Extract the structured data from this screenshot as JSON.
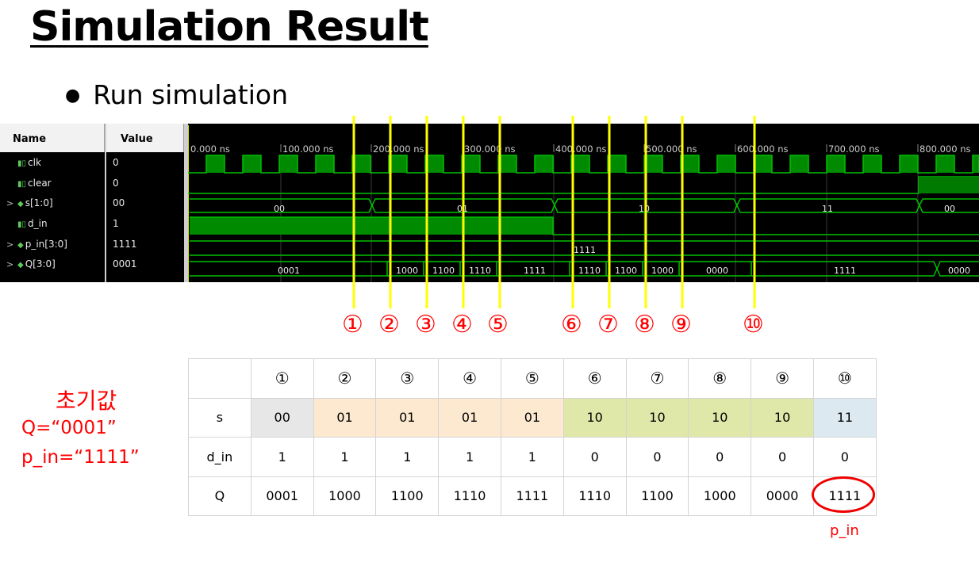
{
  "title": "Simulation Result",
  "bullet": "Run simulation",
  "waveform": {
    "headers": {
      "name": "Name",
      "value": "Value"
    },
    "signals": [
      {
        "name": "clk",
        "value": "0",
        "bus": false
      },
      {
        "name": "clear",
        "value": "0",
        "bus": false
      },
      {
        "name": "s[1:0]",
        "value": "00",
        "bus": true
      },
      {
        "name": "d_in",
        "value": "1",
        "bus": false
      },
      {
        "name": "p_in[3:0]",
        "value": "1111",
        "bus": true
      },
      {
        "name": "Q[3:0]",
        "value": "0001",
        "bus": true
      }
    ],
    "time_labels": [
      "0.000 ns",
      "100.000 ns",
      "200.000 ns",
      "300.000 ns",
      "400.000 ns",
      "500.000 ns",
      "600.000 ns",
      "700.000 ns",
      "800.000 ns"
    ],
    "s_segments": [
      "00",
      "01",
      "10",
      "11",
      "00"
    ],
    "p_in_value": "1111",
    "q_segments": [
      "0001",
      "1000",
      "1100",
      "1110",
      "1111",
      "1110",
      "1100",
      "1000",
      "0000",
      "1111",
      "0000"
    ],
    "wave_color": "#00c000",
    "marker_color": "#ffff00"
  },
  "markers": [
    "①",
    "②",
    "③",
    "④",
    "⑤",
    "⑥",
    "⑦",
    "⑧",
    "⑨",
    "⑩"
  ],
  "initial": {
    "heading": "초기값",
    "q": "Q=“0001”",
    "p_in": "p_in=“1111”"
  },
  "table": {
    "columns": [
      "①",
      "②",
      "③",
      "④",
      "⑤",
      "⑥",
      "⑦",
      "⑧",
      "⑨",
      "⑩"
    ],
    "rows": [
      {
        "label": "s",
        "values": [
          "00",
          "01",
          "01",
          "01",
          "01",
          "10",
          "10",
          "10",
          "10",
          "11"
        ]
      },
      {
        "label": "d_in",
        "values": [
          "1",
          "1",
          "1",
          "1",
          "1",
          "0",
          "0",
          "0",
          "0",
          "0"
        ]
      },
      {
        "label": "Q",
        "values": [
          "0001",
          "1000",
          "1100",
          "1110",
          "1111",
          "1110",
          "1100",
          "1000",
          "0000",
          "1111"
        ]
      }
    ]
  },
  "p_in_note": "p_in"
}
